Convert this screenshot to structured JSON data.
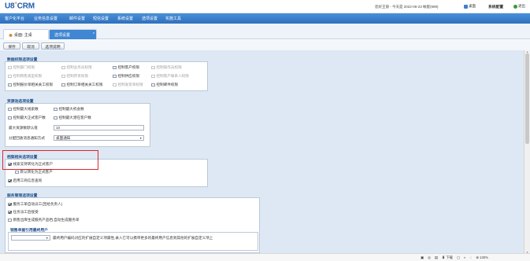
{
  "app": {
    "logo_main": "U8",
    "logo_sup": "+",
    "logo_suffix": "CRM"
  },
  "user": {
    "info": "您好王丽 - 今天是 2022-06-23 帐套(999)",
    "links": [
      "桌面",
      "系统配置"
    ],
    "exit": "退出"
  },
  "menu": [
    "客户化平台",
    "业务信息设置",
    "邮件设置",
    "短信设置",
    "系统设置",
    "选项设置",
    "实施工具"
  ],
  "tabs": {
    "home": "桌面: 主桌",
    "active": "选项设置",
    "close": "x"
  },
  "toolbar": {
    "save": "保存",
    "cancel": "取消",
    "help": "选项说明"
  },
  "sections": {
    "data_permission": {
      "title": "数据权限选项设置",
      "options": [
        {
          "label": "控制部门权限",
          "checked": false,
          "disabled": true
        },
        {
          "label": "控制业务员权限",
          "checked": false,
          "disabled": true
        },
        {
          "label": "控制客户权限",
          "checked": false,
          "disabled": false
        },
        {
          "label": "控制操作员权限",
          "checked": false,
          "disabled": true
        },
        {
          "label": "控制销售类型权限",
          "checked": false,
          "disabled": true
        },
        {
          "label": "控制存货权限",
          "checked": false,
          "disabled": true
        },
        {
          "label": "控制供应权限",
          "checked": false,
          "disabled": false
        },
        {
          "label": "控制客户联系人权限",
          "checked": false,
          "disabled": true
        },
        {
          "label": "控制报价单相关关工权限",
          "checked": false,
          "disabled": false
        },
        {
          "label": "控制订单相关关工权限",
          "checked": false,
          "disabled": false
        },
        {
          "label": "控制发货单权限",
          "checked": false,
          "disabled": true
        },
        {
          "label": "控制邮件权限",
          "checked": false,
          "disabled": false
        }
      ]
    },
    "resource_pool": {
      "title": "资源池选项设置",
      "options": [
        {
          "label": "控制最大线索数",
          "checked": false
        },
        {
          "label": "控制最大机会数",
          "checked": false
        },
        {
          "label": "控制最大正式客户数",
          "checked": false
        },
        {
          "label": "控制最大潜在客户数",
          "checked": false
        }
      ],
      "max_default_label": "最大资源数默认值",
      "max_default_value": "10",
      "notify_label": "分配回收消息通知方式",
      "notify_value": "桌面通知"
    },
    "archive": {
      "title": "档案相关选项设置",
      "options": [
        {
          "label": "线索支持转化为正式客户",
          "checked": true
        },
        {
          "label": "默认转化为正式客户",
          "checked": false
        },
        {
          "label": "启用工商信息查询",
          "checked": true
        }
      ]
    },
    "service": {
      "title": "服务管理选项设置",
      "options": [
        {
          "label": "服务工单自动派工(回给负责人)",
          "checked": true
        },
        {
          "label": "任务派工后接受",
          "checked": true
        },
        {
          "label": "销售出库生成服务产品档,自动生成服务单",
          "checked": false
        }
      ],
      "sub_title": "销售单据引用最终用户",
      "hint": "最终用户编码对应的扩展自定义项属性,录入它可以携带更多的最终用户信息到其他的扩展自定义项上"
    }
  },
  "status": {
    "items": [
      "下载",
      "130%"
    ]
  }
}
